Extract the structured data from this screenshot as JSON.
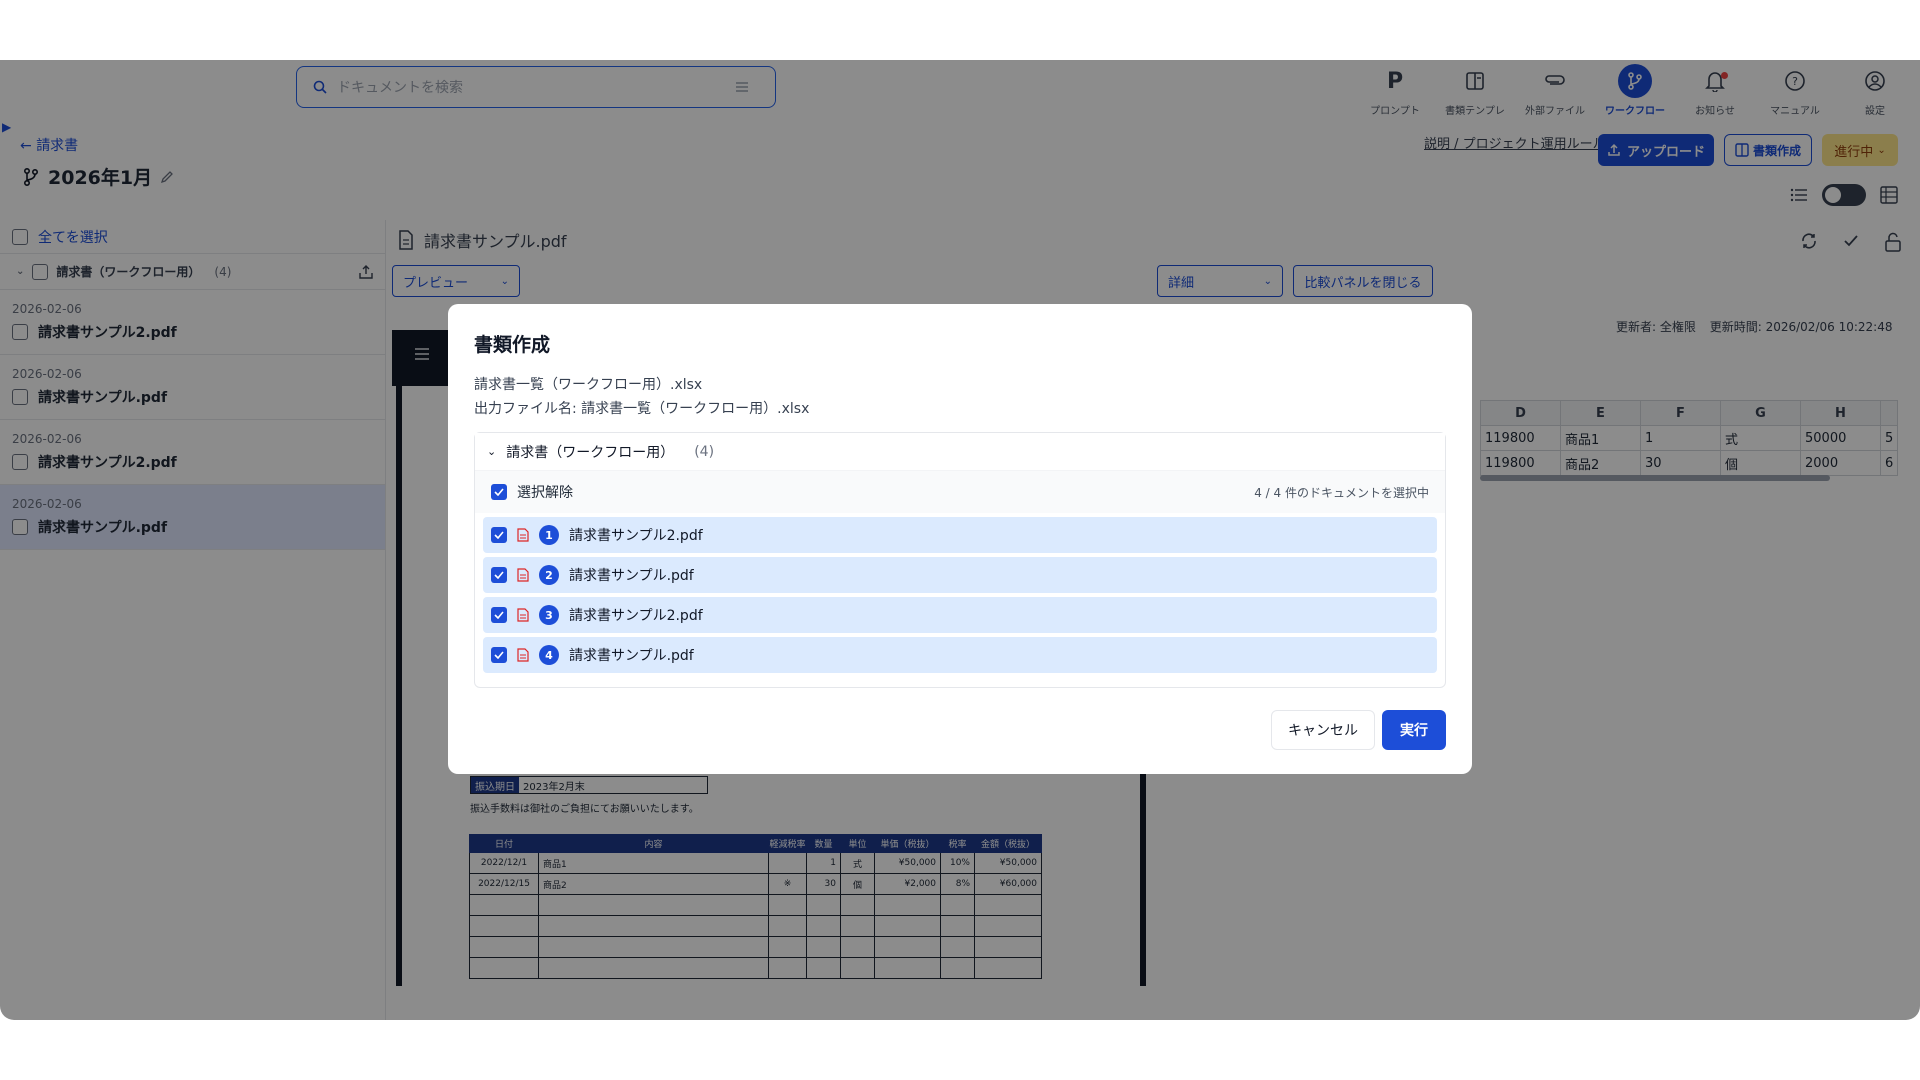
{
  "search": {
    "placeholder": "ドキュメントを検索"
  },
  "nav": [
    {
      "label": "プロンプト",
      "icon": "prompt-icon"
    },
    {
      "label": "書類テンプレ",
      "icon": "template-icon"
    },
    {
      "label": "外部ファイル",
      "icon": "attachment-icon"
    },
    {
      "label": "ワークフロー",
      "icon": "workflow-icon"
    },
    {
      "label": "お知らせ",
      "icon": "bell-icon"
    },
    {
      "label": "マニュアル",
      "icon": "help-icon"
    },
    {
      "label": "設定",
      "icon": "user-icon"
    }
  ],
  "breadcrumb": {
    "back_label": "請求書"
  },
  "page": {
    "title": "2026年1月"
  },
  "toolbar": {
    "rules_link": "説明 / プロジェクト運用ルール",
    "upload_label": "アップロード",
    "create_doc_label": "書類作成",
    "status_label": "進行中"
  },
  "left": {
    "select_all": "全てを選択",
    "group_name": "請求書（ワークフロー用）",
    "group_count": "(4)",
    "files": [
      {
        "date": "2026-02-06",
        "name": "請求書サンプル2.pdf"
      },
      {
        "date": "2026-02-06",
        "name": "請求書サンプル.pdf"
      },
      {
        "date": "2026-02-06",
        "name": "請求書サンプル2.pdf"
      },
      {
        "date": "2026-02-06",
        "name": "請求書サンプル.pdf"
      }
    ]
  },
  "viewer": {
    "file_name": "請求書サンプル.pdf",
    "preview_label": "プレビュー",
    "detail_label": "詳細",
    "close_compare_label": "比較パネルを閉じる",
    "updated_by_label": "更新者:",
    "updated_by": "全権限",
    "updated_at_label": "更新時間:",
    "updated_at": "2026/02/06 10:22:48"
  },
  "sheet": {
    "columns": [
      "D",
      "E",
      "F",
      "G",
      "H",
      ""
    ],
    "rows": [
      [
        "119800",
        "商品1",
        "1",
        "式",
        "50000",
        "5"
      ],
      [
        "119800",
        "商品2",
        "30",
        "個",
        "2000",
        "6"
      ]
    ]
  },
  "invoice": {
    "due_label": "振込期日",
    "due_value": "2023年2月末",
    "fee_note": "振込手数料は御社のご負担にてお願いいたします。",
    "headers": [
      "日付",
      "内容",
      "軽減税率",
      "数量",
      "単位",
      "単価（税抜）",
      "税率",
      "金額（税抜）"
    ],
    "rows": [
      [
        "2022/12/1",
        "商品1",
        "",
        "1",
        "式",
        "¥50,000",
        "10%",
        "¥50,000"
      ],
      [
        "2022/12/15",
        "商品2",
        "※",
        "30",
        "個",
        "¥2,000",
        "8%",
        "¥60,000"
      ],
      [
        "",
        "",
        "",
        "",
        "",
        "",
        "",
        ""
      ],
      [
        "",
        "",
        "",
        "",
        "",
        "",
        "",
        ""
      ],
      [
        "",
        "",
        "",
        "",
        "",
        "",
        "",
        ""
      ],
      [
        "",
        "",
        "",
        "",
        "",
        "",
        "",
        ""
      ]
    ]
  },
  "modal": {
    "title": "書類作成",
    "source_file": "請求書一覧（ワークフロー用）.xlsx",
    "output_file": "出力ファイル名: 請求書一覧（ワークフロー用）.xlsx",
    "group_name": "請求書（ワークフロー用）",
    "group_count": "(4)",
    "deselect_label": "選択解除",
    "selected_info": "4 / 4 件のドキュメントを選択中",
    "items": [
      {
        "num": "1",
        "name": "請求書サンプル2.pdf"
      },
      {
        "num": "2",
        "name": "請求書サンプル.pdf"
      },
      {
        "num": "3",
        "name": "請求書サンプル2.pdf"
      },
      {
        "num": "4",
        "name": "請求書サンプル.pdf"
      }
    ],
    "cancel_label": "キャンセル",
    "run_label": "実行"
  },
  "colors": {
    "accent": "#1d4ed8",
    "selection": "#dbeafe",
    "status": "#fde68a",
    "pdf": "#dc2626"
  }
}
